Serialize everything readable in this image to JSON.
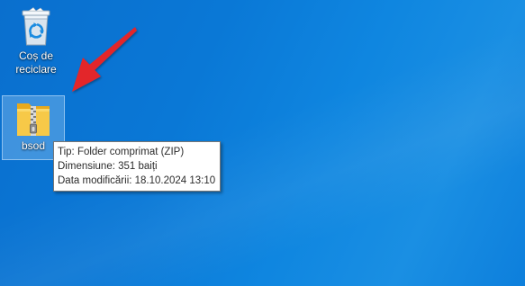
{
  "desktop": {
    "icons": [
      {
        "label_line1": "Coș de",
        "label_line2": "reciclare",
        "icon": "recycle-bin-icon"
      },
      {
        "label": "bsod",
        "icon": "zip-folder-icon"
      }
    ]
  },
  "tooltip": {
    "type": "Tip: Folder comprimat (ZIP)",
    "size": "Dimensiune: 351 baiți",
    "modified": "Data modificării: 18.10.2024 13:10"
  },
  "annotation": {
    "arrow_color": "#e3262b"
  },
  "colors": {
    "desktop_background": "#0a78d6"
  }
}
